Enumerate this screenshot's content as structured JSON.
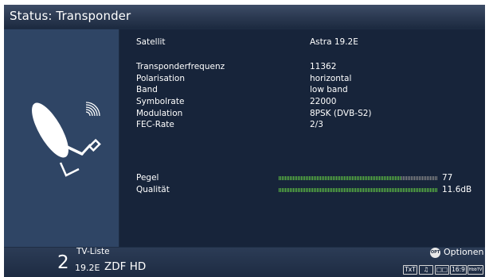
{
  "header": {
    "title": "Status: Transponder"
  },
  "transponder": {
    "rows": [
      {
        "label": "Satellit",
        "value": "Astra 19.2E"
      },
      {
        "label": "Transponderfrequenz",
        "value": "11362"
      },
      {
        "label": "Polarisation",
        "value": "horizontal"
      },
      {
        "label": "Band",
        "value": "low band"
      },
      {
        "label": "Symbolrate",
        "value": "22000"
      },
      {
        "label": "Modulation",
        "value": "8PSK (DVB-S2)"
      },
      {
        "label": "FEC-Rate",
        "value": "2/3"
      }
    ]
  },
  "signal": {
    "pegel": {
      "label": "Pegel",
      "value": "77",
      "level_fraction": 0.77
    },
    "qualitaet": {
      "label": "Qualität",
      "value": "11.6dB",
      "level_fraction": 1.0
    },
    "fill_color": "#5fc043",
    "empty_color": "#8a8a8a"
  },
  "footer": {
    "list_name": "TV-Liste",
    "channel_number": "2",
    "channel_position": "19.2E",
    "channel_name": "ZDF HD",
    "options_button_glyph": "OPT",
    "options_label": "Optionen",
    "badges": [
      "TxT",
      "♫",
      "□□",
      "16:9",
      "HbbTV"
    ]
  },
  "icons": [
    "satellite-dish-icon",
    "signal-waves-icon"
  ],
  "colors": {
    "background": "#1e2d44",
    "left_panel": "#2f4565",
    "main_panel": "#17243a"
  }
}
